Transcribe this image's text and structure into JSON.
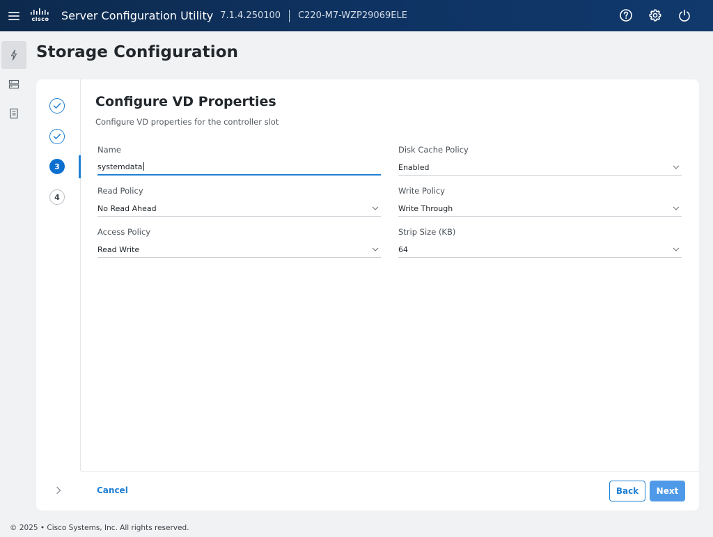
{
  "topbar": {
    "logo_word": "cisco",
    "app_title": "Server Configuration Utility",
    "version": "7.1.4.250100",
    "hostname": "C220-M7-WZP29069ELE",
    "icons": [
      "help-icon",
      "gear-icon",
      "power-icon"
    ]
  },
  "rail": {
    "items": [
      "lightning-icon",
      "server-icon",
      "document-icon"
    ]
  },
  "page": {
    "title": "Storage Configuration"
  },
  "wizard": {
    "steps": [
      {
        "state": "done",
        "label": ""
      },
      {
        "state": "done",
        "label": ""
      },
      {
        "state": "current",
        "label": "3"
      },
      {
        "state": "pending",
        "label": "4"
      }
    ],
    "heading": "Configure VD Properties",
    "subheading": "Configure VD properties for the controller slot",
    "fields": {
      "name": {
        "label": "Name",
        "value": "systemdata"
      },
      "disk_cache_policy": {
        "label": "Disk Cache Policy",
        "value": "Enabled"
      },
      "read_policy": {
        "label": "Read Policy",
        "value": "No Read Ahead"
      },
      "write_policy": {
        "label": "Write Policy",
        "value": "Write Through"
      },
      "access_policy": {
        "label": "Access Policy",
        "value": "Read Write"
      },
      "strip_size": {
        "label": "Strip Size (KB)",
        "value": "64"
      }
    },
    "footer": {
      "cancel_label": "Cancel",
      "back_label": "Back",
      "next_label": "Next"
    }
  },
  "footer": {
    "copyright": "© 2025 • Cisco Systems, Inc. All rights reserved."
  },
  "colors": {
    "topbar": "#0e3363",
    "accent": "#1e7fd3",
    "primary_button": "#4f9ae8",
    "background": "#f1f2f3"
  }
}
